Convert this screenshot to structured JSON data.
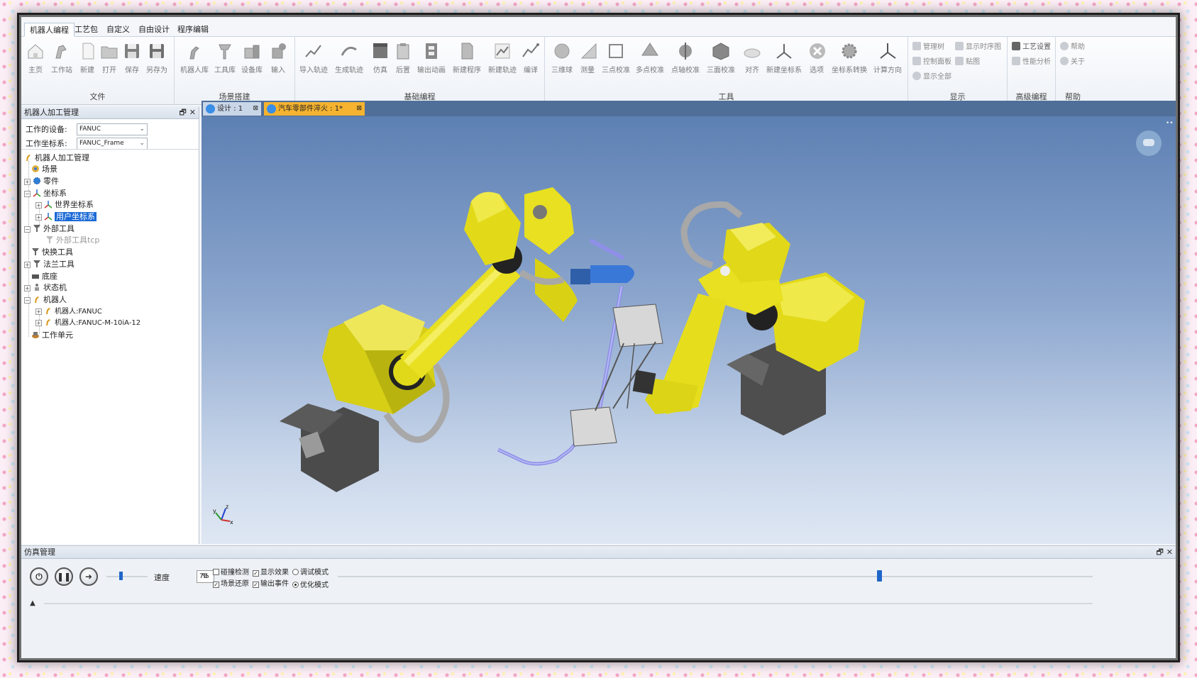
{
  "ribbon": {
    "tabs": [
      {
        "label": "机器人编程",
        "active": true
      },
      {
        "label": "工艺包"
      },
      {
        "label": "自定义"
      },
      {
        "label": "自由设计"
      },
      {
        "label": "程序编辑"
      }
    ],
    "groups": {
      "file": {
        "label": "文件",
        "buttons": [
          "主页",
          "工作站",
          "新建",
          "打开",
          "保存",
          "另存为"
        ]
      },
      "scene": {
        "label": "场景搭建",
        "buttons": [
          "机器人库",
          "工具库",
          "设备库",
          "输入"
        ]
      },
      "basic": {
        "label": "基础编程",
        "buttons": [
          "导入轨迹",
          "生成轨迹",
          "仿真",
          "后置",
          "输出动画",
          "新建程序",
          "新建轨迹",
          "编译"
        ]
      },
      "tools": {
        "label": "工具",
        "buttons": [
          "三维球",
          "测量",
          "三点校准",
          "多点校准",
          "点轴校准",
          "三面校准",
          "对齐",
          "新建坐标系",
          "选项",
          "坐标系转换",
          "计算方向"
        ]
      },
      "display": {
        "label": "显示",
        "buttons": [
          "管理树",
          "显示时序图",
          "控制面板",
          "贴图",
          "显示全部"
        ]
      },
      "advanced": {
        "label": "高级编程",
        "buttons": [
          "工艺设置",
          "性能分析"
        ]
      },
      "help": {
        "label": "帮助",
        "buttons": [
          "帮助",
          "关于"
        ]
      }
    }
  },
  "left_panel": {
    "title": "机器人加工管理",
    "device_label": "工作的设备:",
    "device_value": "FANUC",
    "frame_label": "工作坐标系:",
    "frame_value": "FANUC_Frame",
    "tree": [
      {
        "label": "机器人加工管理",
        "icon": "robot-icon"
      },
      {
        "label": "场景",
        "icon": "scene-icon"
      },
      {
        "label": "零件",
        "icon": "gear-icon"
      },
      {
        "label": "坐标系",
        "icon": "axes-icon"
      },
      {
        "label": "世界坐标系",
        "icon": "axes-icon"
      },
      {
        "label": "用户坐标系",
        "icon": "axes-icon",
        "selected": true
      },
      {
        "label": "外部工具",
        "icon": "tool-icon"
      },
      {
        "label": "外部工具tcp",
        "icon": "tool-icon"
      },
      {
        "label": "快换工具",
        "icon": "tool-icon"
      },
      {
        "label": "法兰工具",
        "icon": "tool-icon"
      },
      {
        "label": "底座",
        "icon": "base-icon"
      },
      {
        "label": "状态机",
        "icon": "state-icon"
      },
      {
        "label": "机器人",
        "icon": "robot-icon"
      },
      {
        "label": "机器人:FANUC",
        "icon": "robot-icon"
      },
      {
        "label": "机器人:FANUC-M-10iA-12",
        "icon": "robot-icon"
      },
      {
        "label": "工作单元",
        "icon": "cell-icon"
      }
    ]
  },
  "doc_tabs": [
    {
      "label": "设计 : 1",
      "close": "⊠"
    },
    {
      "label": "汽车零部件淬火 : 1*",
      "close": "⊠"
    }
  ],
  "sim_panel": {
    "title": "仿真管理",
    "speed_label": "速度",
    "speed_value": "70",
    "speed_unit": "%",
    "checks": {
      "collision": "碰撞检测",
      "show_effect": "显示效果",
      "debug_mode": "调试模式",
      "scene_restore": "场景还原",
      "output_event": "输出事件",
      "optimize_mode": "优化模式"
    }
  },
  "colors": {
    "accent": "#1c6ad6",
    "robot_yellow": "#e8e020",
    "active_doc_tab": "#f5b330"
  }
}
